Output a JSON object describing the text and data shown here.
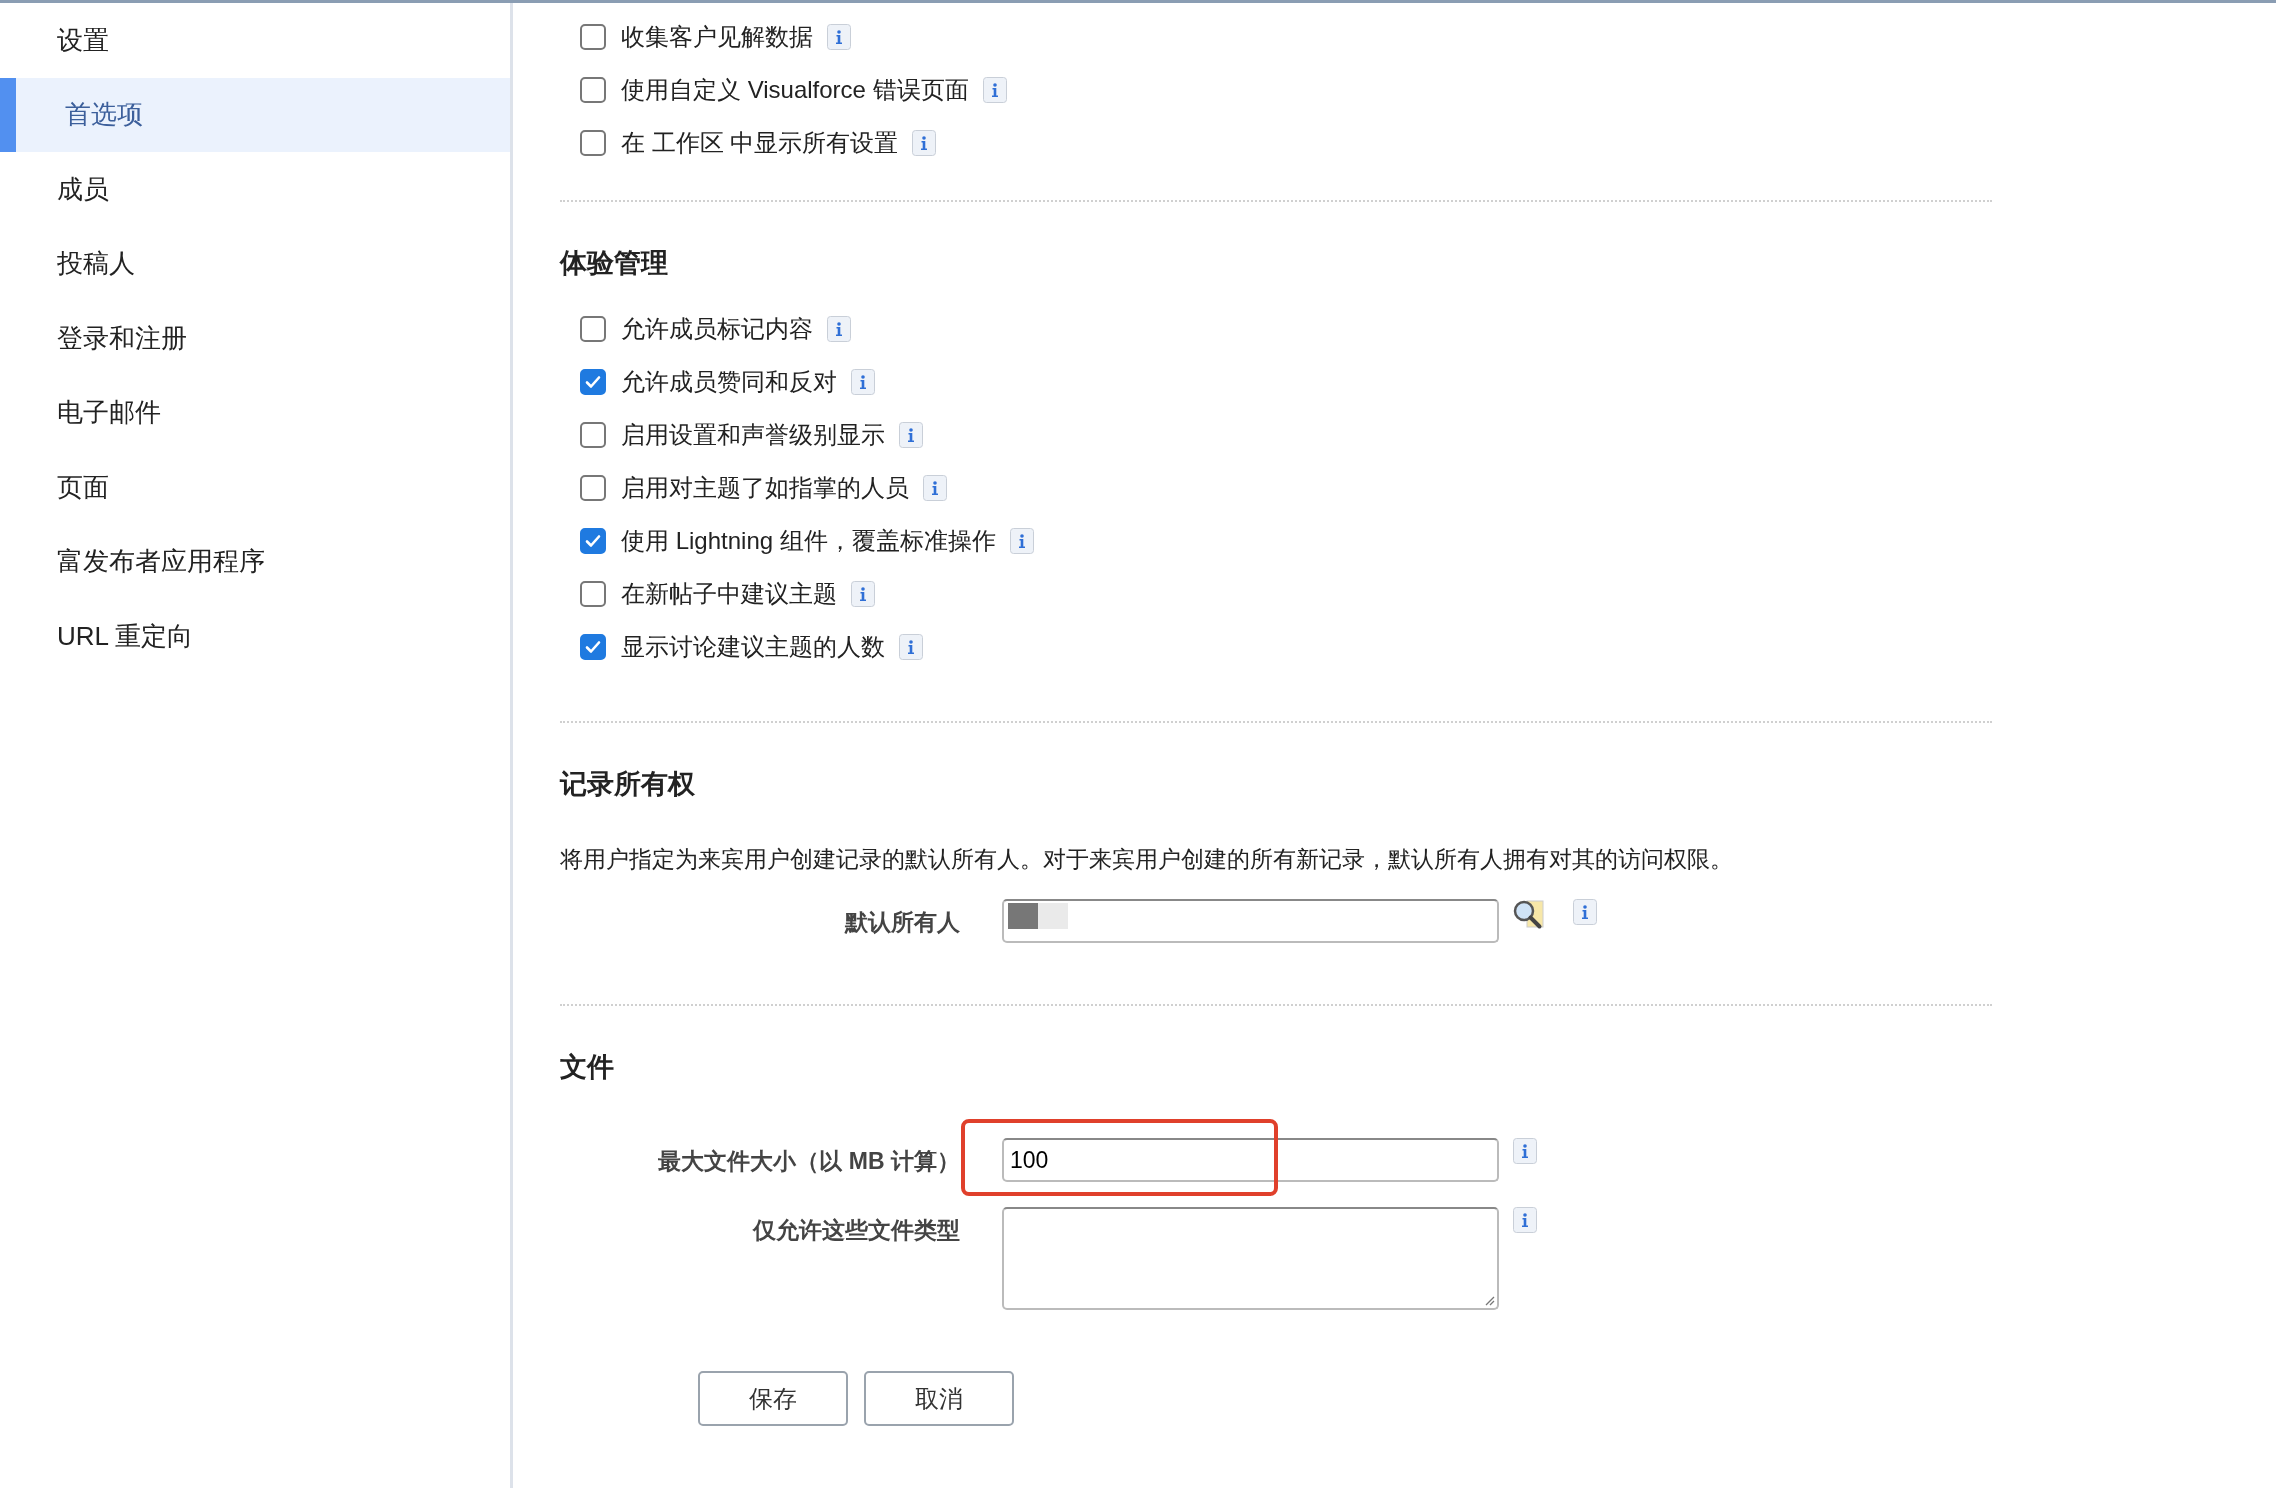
{
  "sidebar": {
    "items": [
      {
        "label": "设置",
        "selected": false
      },
      {
        "label": "首选项",
        "selected": true
      },
      {
        "label": "成员",
        "selected": false
      },
      {
        "label": "投稿人",
        "selected": false
      },
      {
        "label": "登录和注册",
        "selected": false
      },
      {
        "label": "电子邮件",
        "selected": false
      },
      {
        "label": "页面",
        "selected": false
      },
      {
        "label": "富发布者应用程序",
        "selected": false
      },
      {
        "label": "URL 重定向",
        "selected": false
      }
    ]
  },
  "general_options": [
    {
      "label": "收集客户见解数据",
      "checked": false
    },
    {
      "label": "使用自定义 Visualforce 错误页面",
      "checked": false
    },
    {
      "label": "在 工作区 中显示所有设置",
      "checked": false
    }
  ],
  "experience_management": {
    "heading": "体验管理",
    "options": [
      {
        "label": "允许成员标记内容",
        "checked": false
      },
      {
        "label": "允许成员赞同和反对",
        "checked": true
      },
      {
        "label": "启用设置和声誉级别显示",
        "checked": false
      },
      {
        "label": "启用对主题了如指掌的人员",
        "checked": false
      },
      {
        "label": "使用 Lightning 组件，覆盖标准操作",
        "checked": true
      },
      {
        "label": "在新帖子中建议主题",
        "checked": false
      },
      {
        "label": "显示讨论建议主题的人数",
        "checked": true
      }
    ]
  },
  "record_ownership": {
    "heading": "记录所有权",
    "description": "将用户指定为来宾用户创建记录的默认所有人。对于来宾用户创建的所有新记录，默认所有人拥有对其的访问权限。",
    "default_owner": {
      "label": "默认所有人"
    }
  },
  "files": {
    "heading": "文件",
    "fields": [
      {
        "kind": "input",
        "label": "最大文件大小（以 MB 计算）",
        "value": "100",
        "highlighted": true
      },
      {
        "kind": "textarea",
        "label": "仅允许这些文件类型",
        "highlighted": false
      }
    ]
  },
  "buttons": [
    "保存",
    "取消"
  ]
}
